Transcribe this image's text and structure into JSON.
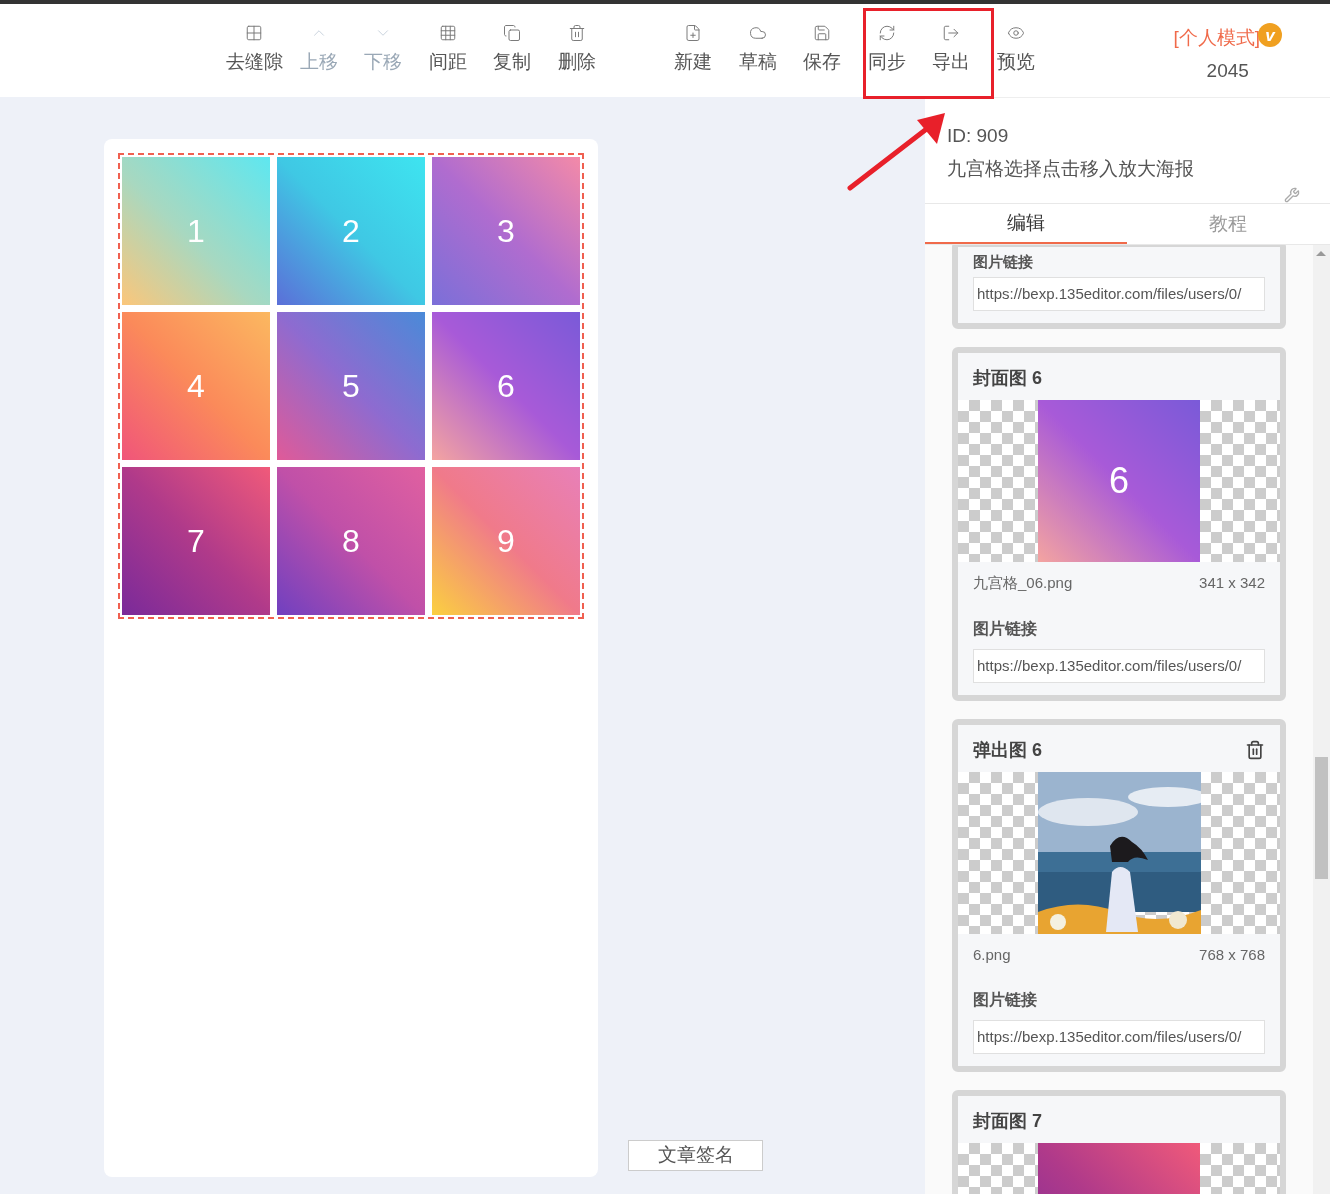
{
  "toolbar": {
    "groups": [
      [
        {
          "kind": "gap",
          "label": "去缝隙",
          "disabled": false
        },
        {
          "kind": "up",
          "label": "上移",
          "disabled": true
        },
        {
          "kind": "down",
          "label": "下移",
          "disabled": true
        },
        {
          "kind": "spacing",
          "label": "间距",
          "disabled": false
        },
        {
          "kind": "copy",
          "label": "复制",
          "disabled": false
        },
        {
          "kind": "delete",
          "label": "删除",
          "disabled": false
        }
      ],
      [
        {
          "kind": "new",
          "label": "新建",
          "disabled": false
        },
        {
          "kind": "draft",
          "label": "草稿",
          "disabled": false
        },
        {
          "kind": "save",
          "label": "保存",
          "disabled": false
        },
        {
          "kind": "sync",
          "label": "同步",
          "disabled": false
        },
        {
          "kind": "export",
          "label": "导出",
          "disabled": false
        },
        {
          "kind": "preview",
          "label": "预览",
          "disabled": false
        }
      ]
    ],
    "mode": "[个人模式]",
    "badge": "v",
    "count": "2045"
  },
  "canvas": {
    "tiles": [
      "1",
      "2",
      "3",
      "4",
      "5",
      "6",
      "7",
      "8",
      "9"
    ],
    "signature_button": "文章签名"
  },
  "panel": {
    "id": "ID: 909",
    "description": "九宫格选择点击移入放大海报",
    "tabs": [
      {
        "label": "编辑",
        "selected": true
      },
      {
        "label": "教程",
        "selected": false
      }
    ],
    "cards": [
      {
        "kind": "partial",
        "link_label": "图片链接",
        "url": "https://bexp.135editor.com/files/users/0/"
      },
      {
        "kind": "cover",
        "title": "封面图 6",
        "tile": "6",
        "filename": "九宫格_06.png",
        "size": "341 x 342",
        "link_label": "图片链接",
        "url": "https://bexp.135editor.com/files/users/0/"
      },
      {
        "kind": "popup",
        "title": "弹出图 6",
        "filename": "6.png",
        "size": "768 x 768",
        "link_label": "图片链接",
        "url": "https://bexp.135editor.com/files/users/0/"
      },
      {
        "kind": "cover_cut",
        "title": "封面图 7"
      }
    ]
  }
}
